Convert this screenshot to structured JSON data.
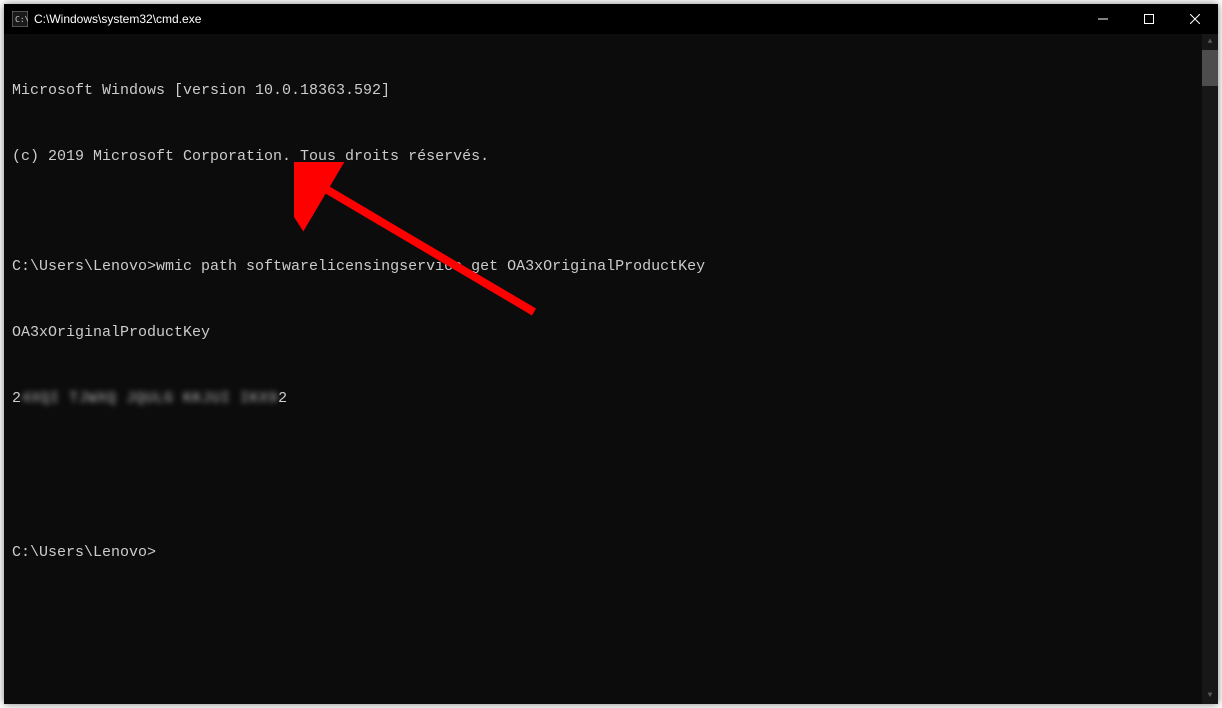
{
  "titlebar": {
    "title": "C:\\Windows\\system32\\cmd.exe"
  },
  "terminal": {
    "line1": "Microsoft Windows [version 10.0.18363.592]",
    "line2": "(c) 2019 Microsoft Corporation. Tous droits réservés.",
    "blank1": "",
    "prompt1_path": "C:\\Users\\Lenovo>",
    "prompt1_cmd": "wmic path softwarelicensingservice get OA3xOriginalProductKey",
    "header": "OA3xOriginalProductKey",
    "key_start": "2",
    "key_blurred": "4XQI TJWXQ JQULG KKJUI IKX9",
    "key_end": "2",
    "blank2": "",
    "blank3": "",
    "prompt2_path": "C:\\Users\\Lenovo>"
  }
}
